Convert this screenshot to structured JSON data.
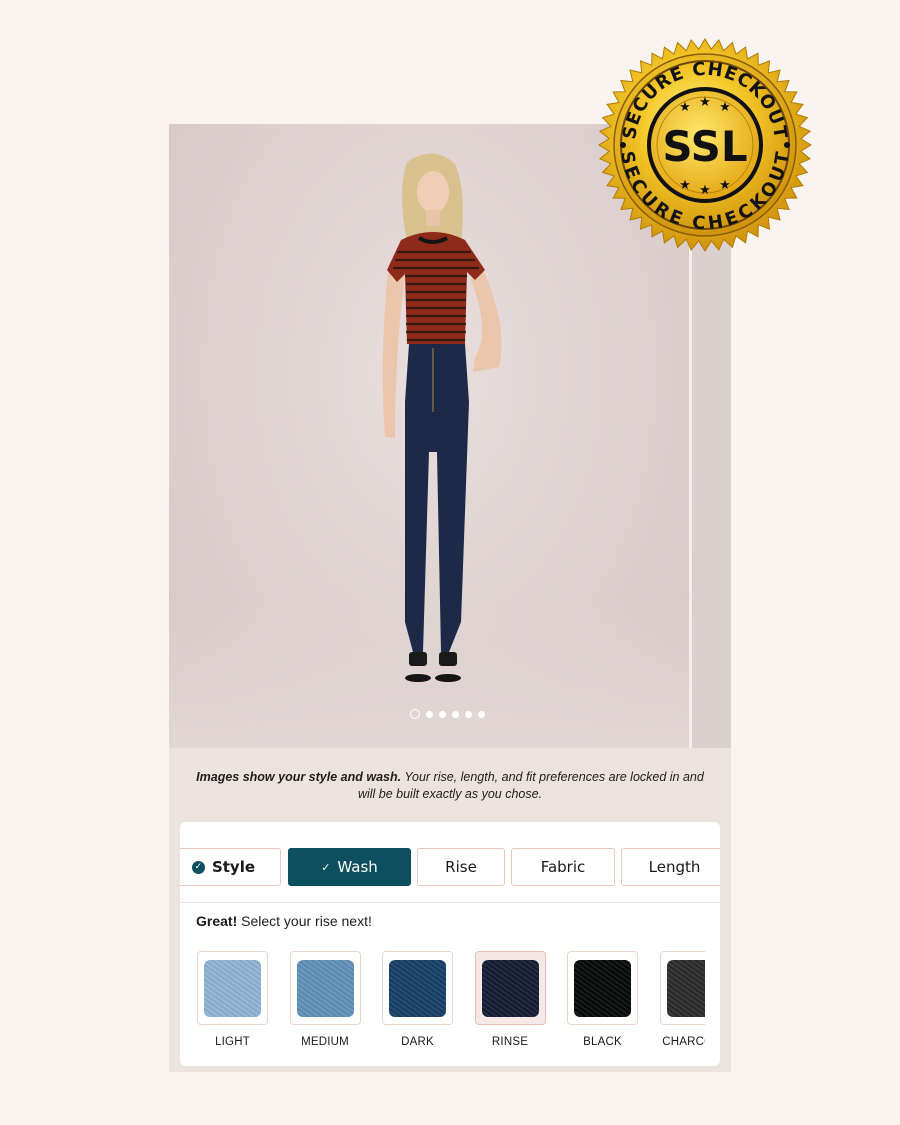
{
  "gallery": {
    "slide_count": 6,
    "active_slide": 1
  },
  "caption": {
    "bold_text": "Images show your style and wash.",
    "text": " Your rise, length, and fit preferences are locked in and will be built exactly as you chose."
  },
  "steps": [
    {
      "label": "Style",
      "state": "done"
    },
    {
      "label": "Wash",
      "state": "active"
    },
    {
      "label": "Rise",
      "state": "todo"
    },
    {
      "label": "Fabric",
      "state": "todo"
    },
    {
      "label": "Length",
      "state": "todo"
    }
  ],
  "prompt": {
    "bold_text": "Great!",
    "text": " Select your rise next!"
  },
  "washes": [
    {
      "label": "LIGHT",
      "color": "#8fb3d4",
      "selected": false
    },
    {
      "label": "MEDIUM",
      "color": "#5f8fb8",
      "selected": false
    },
    {
      "label": "DARK",
      "color": "#163e66",
      "selected": false
    },
    {
      "label": "RINSE",
      "color": "#131a33",
      "selected": true
    },
    {
      "label": "BLACK",
      "color": "#060808",
      "selected": false
    },
    {
      "label": "CHARCOAL",
      "color": "#2b2b2d",
      "selected": false
    }
  ],
  "badge": {
    "top_text": "SECURE CHECKOUT",
    "center_text": "SSL",
    "bottom_text": "SECURE CHECKOUT"
  }
}
